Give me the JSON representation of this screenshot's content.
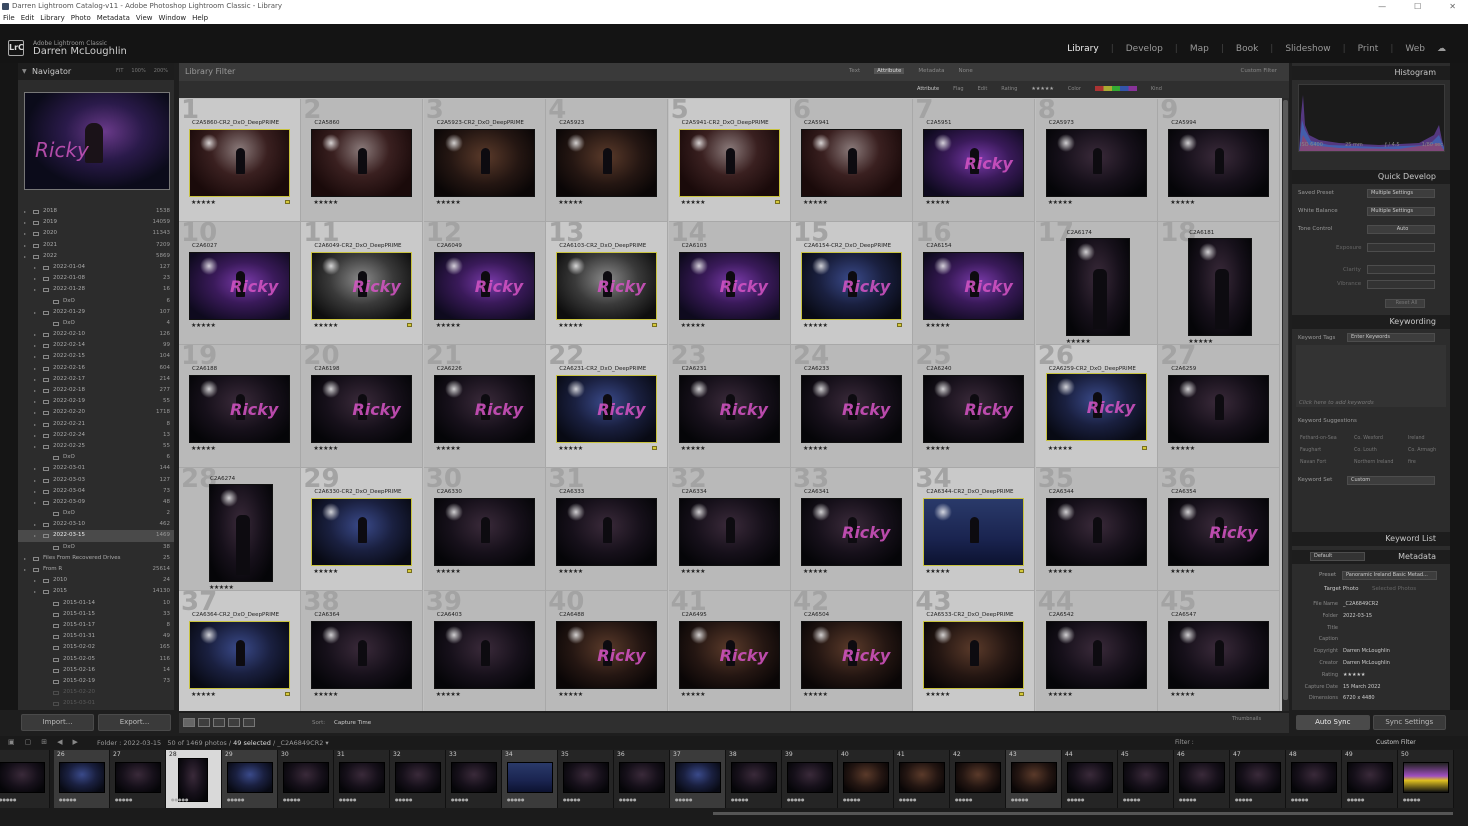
{
  "window": {
    "title": "Darren Lightroom Catalog-v11 - Adobe Photoshop Lightroom Classic - Library"
  },
  "menu": [
    "File",
    "Edit",
    "Library",
    "Photo",
    "Metadata",
    "View",
    "Window",
    "Help"
  ],
  "identity": {
    "app": "Adobe Lightroom Classic",
    "user": "Darren McLoughlin"
  },
  "modules": [
    {
      "label": "Library",
      "active": true
    },
    {
      "label": "Develop"
    },
    {
      "label": "Map"
    },
    {
      "label": "Book"
    },
    {
      "label": "Slideshow"
    },
    {
      "label": "Print"
    },
    {
      "label": "Web"
    }
  ],
  "navigator": {
    "title": "Navigator",
    "zoom": [
      "FIT",
      "100%",
      "200%"
    ]
  },
  "folders": [
    {
      "name": "2018",
      "count": "1538",
      "level": 1
    },
    {
      "name": "2019",
      "count": "14059",
      "level": 1
    },
    {
      "name": "2020",
      "count": "11343",
      "level": 1
    },
    {
      "name": "2021",
      "count": "7209",
      "level": 1
    },
    {
      "name": "2022",
      "count": "5869",
      "level": 1
    },
    {
      "name": "2022-01-04",
      "count": "127",
      "level": 2
    },
    {
      "name": "2022-01-08",
      "count": "23",
      "level": 2
    },
    {
      "name": "2022-01-28",
      "count": "16",
      "level": 2
    },
    {
      "name": "DxO",
      "count": "6",
      "level": 3
    },
    {
      "name": "2022-01-29",
      "count": "107",
      "level": 2
    },
    {
      "name": "DxO",
      "count": "4",
      "level": 3
    },
    {
      "name": "2022-02-10",
      "count": "126",
      "level": 2
    },
    {
      "name": "2022-02-14",
      "count": "99",
      "level": 2
    },
    {
      "name": "2022-02-15",
      "count": "104",
      "level": 2
    },
    {
      "name": "2022-02-16",
      "count": "604",
      "level": 2
    },
    {
      "name": "2022-02-17",
      "count": "214",
      "level": 2
    },
    {
      "name": "2022-02-18",
      "count": "277",
      "level": 2
    },
    {
      "name": "2022-02-19",
      "count": "55",
      "level": 2
    },
    {
      "name": "2022-02-20",
      "count": "1718",
      "level": 2
    },
    {
      "name": "2022-02-21",
      "count": "8",
      "level": 2
    },
    {
      "name": "2022-02-24",
      "count": "13",
      "level": 2
    },
    {
      "name": "2022-02-25",
      "count": "55",
      "level": 2
    },
    {
      "name": "DxO",
      "count": "6",
      "level": 3
    },
    {
      "name": "2022-03-01",
      "count": "144",
      "level": 2
    },
    {
      "name": "2022-03-03",
      "count": "127",
      "level": 2
    },
    {
      "name": "2022-03-04",
      "count": "73",
      "level": 2
    },
    {
      "name": "2022-03-09",
      "count": "48",
      "level": 2
    },
    {
      "name": "DxO",
      "count": "2",
      "level": 3
    },
    {
      "name": "2022-03-10",
      "count": "462",
      "level": 2
    },
    {
      "name": "2022-03-15",
      "count": "1469",
      "level": 2,
      "selected": true
    },
    {
      "name": "DxO",
      "count": "38",
      "level": 3
    },
    {
      "name": "Files From Recovered Drives",
      "count": "25",
      "level": 1
    },
    {
      "name": "From R",
      "count": "25614",
      "level": 1
    },
    {
      "name": "2010",
      "count": "24",
      "level": 2
    },
    {
      "name": "2015",
      "count": "14130",
      "level": 2
    },
    {
      "name": "2015-01-14",
      "count": "10",
      "level": 3
    },
    {
      "name": "2015-01-15",
      "count": "33",
      "level": 3
    },
    {
      "name": "2015-01-17",
      "count": "8",
      "level": 3
    },
    {
      "name": "2015-01-31",
      "count": "49",
      "level": 3
    },
    {
      "name": "2015-02-02",
      "count": "165",
      "level": 3
    },
    {
      "name": "2015-02-05",
      "count": "116",
      "level": 3
    },
    {
      "name": "2015-02-16",
      "count": "14",
      "level": 3
    },
    {
      "name": "2015-02-19",
      "count": "73",
      "level": 3
    },
    {
      "name": "2015-02-20",
      "count": "",
      "level": 3
    },
    {
      "name": "2015-03-01",
      "count": "",
      "level": 3
    }
  ],
  "left_buttons": {
    "import": "Import...",
    "export": "Export..."
  },
  "filter": {
    "title": "Library Filter",
    "tabs": [
      "Text",
      "Attribute",
      "Metadata",
      "None"
    ],
    "active_tab": "Attribute",
    "preset": "Custom Filter",
    "attribute_items": [
      "Attribute",
      "Flag",
      "Edit",
      "Rating",
      "Color",
      "Kind"
    ],
    "rating_stars": "★★★★★"
  },
  "grid": [
    {
      "n": "1",
      "name": "C2A5860-CR2_DxO_DeepPRIME",
      "stars": "★★★★★",
      "sel": true,
      "flag": true,
      "orient": "h",
      "tone": "mix"
    },
    {
      "n": "2",
      "name": "C2A5860",
      "stars": "★★★★★",
      "tone": "mix"
    },
    {
      "n": "3",
      "name": "C2A5923-CR2_DxO_DeepPRIME",
      "stars": "★★★★★",
      "tone": "warm"
    },
    {
      "n": "4",
      "name": "C2A5923",
      "stars": "★★★★★",
      "tone": "warm"
    },
    {
      "n": "5",
      "name": "C2A5941-CR2_DxO_DeepPRIME",
      "stars": "★★★★★",
      "sel": true,
      "flag": true,
      "tone": "mix"
    },
    {
      "n": "6",
      "name": "C2A5941",
      "stars": "★★★★★",
      "tone": "mix"
    },
    {
      "n": "7",
      "name": "C2A5951",
      "stars": "★★★★★",
      "tone": "purple",
      "neon": true
    },
    {
      "n": "8",
      "name": "C2A5973",
      "stars": "★★★★★",
      "tone": "dark"
    },
    {
      "n": "9",
      "name": "C2A5994",
      "stars": "★★★★★",
      "tone": "dark"
    },
    {
      "n": "10",
      "name": "C2A6027",
      "stars": "★★★★★",
      "tone": "purple",
      "neon": true
    },
    {
      "n": "11",
      "name": "C2A6049-CR2_DxO_DeepPRIME",
      "stars": "★★★★★",
      "sel": true,
      "flag": true,
      "tone": "gray",
      "neon": true
    },
    {
      "n": "12",
      "name": "C2A6049",
      "stars": "★★★★★",
      "tone": "purple",
      "neon": true
    },
    {
      "n": "13",
      "name": "C2A6103-CR2_DxO_DeepPRIME",
      "stars": "★★★★★",
      "sel": true,
      "flag": true,
      "tone": "gray",
      "neon": true
    },
    {
      "n": "14",
      "name": "C2A6103",
      "stars": "★★★★★",
      "tone": "purple",
      "neon": true
    },
    {
      "n": "15",
      "name": "C2A6154-CR2_DxO_DeepPRIME",
      "stars": "★★★★★",
      "sel": true,
      "flag": true,
      "tone": "blue",
      "neon": true
    },
    {
      "n": "16",
      "name": "C2A6154",
      "stars": "★★★★★",
      "tone": "purple",
      "neon": true
    },
    {
      "n": "17",
      "name": "C2A6174",
      "stars": "★★★★★",
      "tone": "dark",
      "portrait": true
    },
    {
      "n": "18",
      "name": "C2A6181",
      "stars": "★★★★★",
      "tone": "dark",
      "portrait": true
    },
    {
      "n": "19",
      "name": "C2A6188",
      "stars": "★★★★★",
      "tone": "dark",
      "neon": true
    },
    {
      "n": "20",
      "name": "C2A6198",
      "stars": "★★★★★",
      "tone": "dark",
      "neon": true
    },
    {
      "n": "21",
      "name": "C2A6226",
      "stars": "★★★★★",
      "tone": "dark",
      "neon": true
    },
    {
      "n": "22",
      "name": "C2A6231-CR2_DxO_DeepPRIME",
      "stars": "★★★★★",
      "sel": true,
      "flag": true,
      "tone": "blue",
      "neon": true
    },
    {
      "n": "23",
      "name": "C2A6231",
      "stars": "★★★★★",
      "tone": "dark",
      "neon": true
    },
    {
      "n": "24",
      "name": "C2A6233",
      "stars": "★★★★★",
      "tone": "dark",
      "neon": true
    },
    {
      "n": "25",
      "name": "C2A6240",
      "stars": "★★★★★",
      "tone": "dark",
      "neon": true
    },
    {
      "n": "26",
      "name": "C2A6259-CR2_DxO_DeepPRIME",
      "stars": "★★★★★",
      "sel": true,
      "flag": true,
      "tone": "blue",
      "neon": true
    },
    {
      "n": "27",
      "name": "C2A6259",
      "stars": "★★★★★",
      "tone": "dark"
    },
    {
      "n": "28",
      "name": "C2A6274",
      "stars": "★★★★★",
      "tone": "dark",
      "portrait": true
    },
    {
      "n": "29",
      "name": "C2A6330-CR2_DxO_DeepPRIME",
      "stars": "★★★★★",
      "sel": true,
      "flag": true,
      "tone": "blue"
    },
    {
      "n": "30",
      "name": "C2A6330",
      "stars": "★★★★★",
      "tone": "dark"
    },
    {
      "n": "31",
      "name": "C2A6333",
      "stars": "★★★★★",
      "tone": "dark"
    },
    {
      "n": "32",
      "name": "C2A6334",
      "stars": "★★★★★",
      "tone": "dark"
    },
    {
      "n": "33",
      "name": "C2A6341",
      "stars": "★★★★★",
      "tone": "dark",
      "neon": true
    },
    {
      "n": "34",
      "name": "C2A6344-CR2_DxO_DeepPRIME",
      "stars": "★★★★★",
      "sel": true,
      "flag": true,
      "tone": "navy"
    },
    {
      "n": "35",
      "name": "C2A6344",
      "stars": "★★★★★",
      "tone": "dark"
    },
    {
      "n": "36",
      "name": "C2A6354",
      "stars": "★★★★★",
      "tone": "dark",
      "neon": true
    },
    {
      "n": "37",
      "name": "C2A6364-CR2_DxO_DeepPRIME",
      "stars": "★★★★★",
      "sel": true,
      "flag": true,
      "tone": "blue"
    },
    {
      "n": "38",
      "name": "C2A6364",
      "stars": "★★★★★",
      "tone": "dark"
    },
    {
      "n": "39",
      "name": "C2A6403",
      "stars": "★★★★★",
      "tone": "dark"
    },
    {
      "n": "40",
      "name": "C2A6488",
      "stars": "★★★★★",
      "tone": "warm",
      "neon": true
    },
    {
      "n": "41",
      "name": "C2A6495",
      "stars": "★★★★★",
      "tone": "warm",
      "neon": true
    },
    {
      "n": "42",
      "name": "C2A6504",
      "stars": "★★★★★",
      "tone": "warm",
      "neon": true
    },
    {
      "n": "43",
      "name": "C2A6533-CR2_DxO_DeepPRIME",
      "stars": "★★★★★",
      "sel": true,
      "flag": true,
      "tone": "warm"
    },
    {
      "n": "44",
      "name": "C2A6542",
      "stars": "★★★★★",
      "tone": "dark"
    },
    {
      "n": "45",
      "name": "C2A6547",
      "stars": "★★★★★",
      "tone": "dark"
    }
  ],
  "toolbar": {
    "sort_label": "Sort:",
    "sort_value": "Capture Time",
    "thumbs_label": "Thumbnails"
  },
  "right": {
    "histogram_title": "Histogram",
    "hist_info": [
      "ISO 6400",
      "25 mm",
      "ƒ / 4.5",
      "1/80 sec"
    ],
    "quick_develop": "Quick Develop",
    "saved_preset_label": "Saved Preset",
    "saved_preset": "Multiple Settings",
    "wb_label": "White Balance",
    "wb": "Multiple Settings",
    "tone_label": "Tone Control",
    "tone": "Auto",
    "exposure": "Exposure",
    "clarity": "Clarity",
    "vibrance": "Vibrance",
    "reset": "Reset All",
    "keywording": "Keywording",
    "kw_tags_label": "Keyword Tags",
    "kw_tags": "Enter Keywords",
    "kw_hint": "Click here to add keywords",
    "kw_sugg_title": "Keyword Suggestions",
    "kw_sugg": [
      "Fethard-on-Sea",
      "Co. Wexford",
      "Ireland",
      "Faughart",
      "Co. Louth",
      "Co. Armagh",
      "Navan Fort",
      "Northern Ireland",
      "fire"
    ],
    "kw_set_label": "Keyword Set",
    "kw_set": "Custom",
    "kw_list": "Keyword List",
    "metadata": "Metadata",
    "meta_default": "Default",
    "preset_label": "Preset",
    "preset": "Panoramic Ireland Basic Metad...",
    "target": "Target Photo",
    "selected": "Selected Photos",
    "meta_fields": [
      {
        "k": "File Name",
        "v": "_C2A6849CR2"
      },
      {
        "k": "Folder",
        "v": "2022-03-15"
      },
      {
        "k": "Title",
        "v": ""
      },
      {
        "k": "Caption",
        "v": ""
      },
      {
        "k": "Copyright",
        "v": "Darren McLoughlin"
      },
      {
        "k": "Creator",
        "v": "Darren McLoughlin"
      },
      {
        "k": "Rating",
        "v": "★★★★★"
      },
      {
        "k": "Capture Date",
        "v": "15 March 2022"
      },
      {
        "k": "Dimensions",
        "v": "6720 x 4480"
      }
    ],
    "auto_sync": "Auto Sync",
    "sync_settings": "Sync Settings"
  },
  "filmbar": {
    "folder": "Folder : 2022-03-15",
    "count": "50 of 1469 photos /",
    "selected": "49 selected",
    "current": "/ _C2A6849CR2 ▾",
    "filter": "Filter :",
    "custom": "Custom Filter"
  },
  "filmstrip": [
    {
      "n": "",
      "tone": "dark"
    },
    {
      "n": "26",
      "tone": "blue",
      "sel": true
    },
    {
      "n": "27",
      "tone": "dark"
    },
    {
      "n": "28",
      "tone": "dark",
      "cur": true
    },
    {
      "n": "29",
      "tone": "blue",
      "sel": true
    },
    {
      "n": "30",
      "tone": "dark"
    },
    {
      "n": "31",
      "tone": "dark"
    },
    {
      "n": "32",
      "tone": "dark"
    },
    {
      "n": "33",
      "tone": "dark"
    },
    {
      "n": "34",
      "tone": "navy",
      "sel": true
    },
    {
      "n": "35",
      "tone": "dark"
    },
    {
      "n": "36",
      "tone": "dark"
    },
    {
      "n": "37",
      "tone": "blue",
      "sel": true
    },
    {
      "n": "38",
      "tone": "dark"
    },
    {
      "n": "39",
      "tone": "dark"
    },
    {
      "n": "40",
      "tone": "warm"
    },
    {
      "n": "41",
      "tone": "warm"
    },
    {
      "n": "42",
      "tone": "warm"
    },
    {
      "n": "43",
      "tone": "warm",
      "sel": true
    },
    {
      "n": "44",
      "tone": "dark"
    },
    {
      "n": "45",
      "tone": "dark"
    },
    {
      "n": "46",
      "tone": "dark"
    },
    {
      "n": "47",
      "tone": "dark"
    },
    {
      "n": "48",
      "tone": "dark"
    },
    {
      "n": "49",
      "tone": "dark"
    },
    {
      "n": "50",
      "tone": "glow"
    }
  ]
}
